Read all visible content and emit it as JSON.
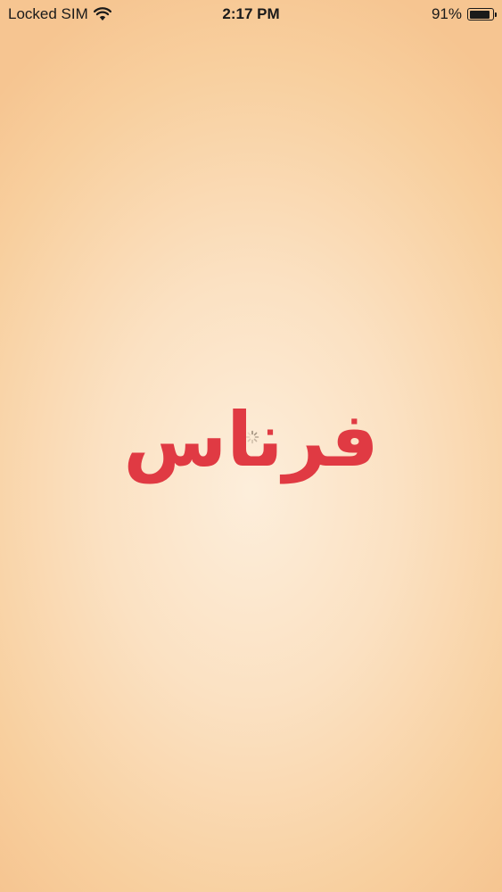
{
  "status_bar": {
    "carrier": "Locked SIM",
    "time": "2:17 PM",
    "battery_percent": "91%",
    "battery_level": 0.91,
    "wifi_icon": "wifi-icon",
    "battery_icon": "battery-icon"
  },
  "splash": {
    "logo_text": "فرناس",
    "logo_color": "#e03a43",
    "loading_icon": "activity-spinner-icon"
  }
}
